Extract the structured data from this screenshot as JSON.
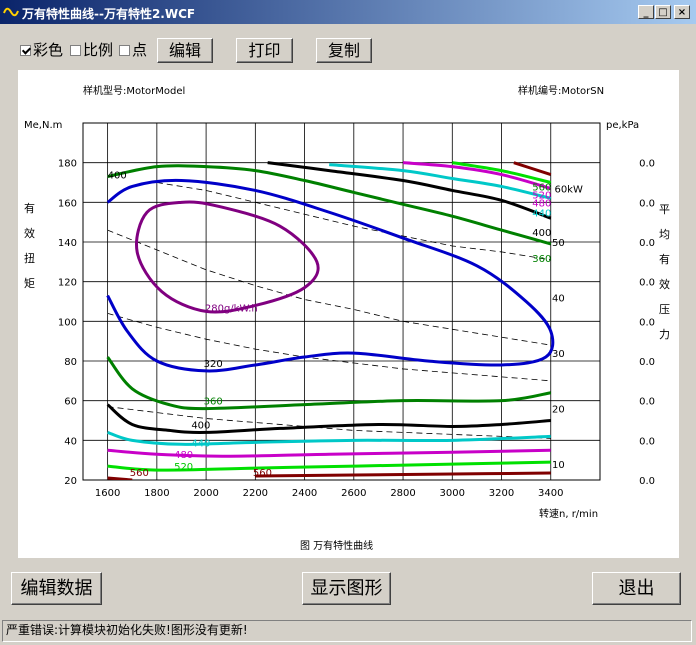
{
  "window": {
    "title": "万有特性曲线--万有特性2.WCF",
    "min_label": "_",
    "max_label": "□",
    "close_label": "×"
  },
  "toolbar": {
    "color_label": "彩色",
    "color_checked": true,
    "ratio_label": "比例",
    "ratio_checked": false,
    "point_label": "点",
    "point_checked": false,
    "edit_button": "编辑",
    "print_button": "打印",
    "copy_button": "复制"
  },
  "buttons": {
    "edit_data": "编辑数据",
    "show_chart": "显示图形",
    "exit": "退出"
  },
  "status": {
    "message": "严重错误:计算模块初始化失败!图形没有更新!"
  },
  "chart_data": {
    "type": "line",
    "model_label": "样机型号:MotorModel",
    "sn_label": "样机编号:MotorSN",
    "left_unit": "Me,N.m",
    "left_axis_title": [
      "有",
      "效",
      "扭",
      "矩"
    ],
    "right_unit": "pe,kPa",
    "right_axis_title": [
      "平",
      "均",
      "有",
      "效",
      "压",
      "力"
    ],
    "x_axis_label": "转速n, r/min",
    "caption": "图   万有特性曲线",
    "x_ticks": [
      1600,
      1800,
      2000,
      2200,
      2400,
      2600,
      2800,
      3000,
      3200,
      3400
    ],
    "y_ticks": [
      20,
      40,
      60,
      80,
      100,
      120,
      140,
      160,
      180
    ],
    "right_ticks": [
      "0.0",
      "0.0",
      "0.0",
      "0.0",
      "0.0",
      "0.0",
      "0.0",
      "0.0",
      "0.0"
    ],
    "xlim": [
      1600,
      3400
    ],
    "ylim": [
      20,
      180
    ],
    "power_labels": [
      {
        "text": "60kW",
        "x": 3415,
        "y": 167
      },
      {
        "text": "50",
        "x": 3405,
        "y": 140
      },
      {
        "text": "40",
        "x": 3405,
        "y": 112
      },
      {
        "text": "30",
        "x": 3405,
        "y": 84
      },
      {
        "text": "20",
        "x": 3405,
        "y": 56
      },
      {
        "text": "10",
        "x": 3405,
        "y": 28
      }
    ],
    "contour_labels": [
      {
        "text": "400",
        "x": 1600,
        "y": 174,
        "color": "#000000"
      },
      {
        "text": "280g/kW.h",
        "x": 1995,
        "y": 107,
        "color": "#800080"
      },
      {
        "text": "320",
        "x": 1990,
        "y": 79,
        "color": "#000000"
      },
      {
        "text": "360",
        "x": 1990,
        "y": 60,
        "color": "#008000"
      },
      {
        "text": "400",
        "x": 1940,
        "y": 48,
        "color": "#000000"
      },
      {
        "text": "440",
        "x": 1940,
        "y": 39,
        "color": "#00c8c8"
      },
      {
        "text": "480",
        "x": 1870,
        "y": 33,
        "color": "#c800c8"
      },
      {
        "text": "520",
        "x": 1870,
        "y": 27,
        "color": "#00c800"
      },
      {
        "text": "560",
        "x": 1690,
        "y": 24,
        "color": "#800000"
      },
      {
        "text": "560",
        "x": 2190,
        "y": 24,
        "color": "#800000"
      },
      {
        "text": "560",
        "x": 3325,
        "y": 168,
        "color": "#008000"
      },
      {
        "text": "520",
        "x": 3325,
        "y": 164,
        "color": "#c800c8"
      },
      {
        "text": "480",
        "x": 3325,
        "y": 160,
        "color": "#c800c8"
      },
      {
        "text": "440",
        "x": 3325,
        "y": 155,
        "color": "#00c8c8"
      },
      {
        "text": "400",
        "x": 3325,
        "y": 145,
        "color": "#000000"
      },
      {
        "text": "360",
        "x": 3325,
        "y": 132,
        "color": "#008000"
      }
    ],
    "series": [
      {
        "color": "#800080",
        "closed": true,
        "values": [
          [
            1900,
            160
          ],
          [
            2050,
            158
          ],
          [
            2300,
            148
          ],
          [
            2450,
            130
          ],
          [
            2400,
            117
          ],
          [
            2200,
            108
          ],
          [
            2000,
            105
          ],
          [
            1820,
            115
          ],
          [
            1720,
            135
          ],
          [
            1760,
            155
          ]
        ]
      },
      {
        "color": "#0000c8",
        "values": [
          [
            1600,
            160
          ],
          [
            1700,
            168
          ],
          [
            1900,
            171
          ],
          [
            2200,
            166
          ],
          [
            2500,
            155
          ],
          [
            2800,
            142
          ],
          [
            3100,
            128
          ],
          [
            3300,
            110
          ],
          [
            3400,
            95
          ],
          [
            3380,
            82
          ],
          [
            3200,
            78
          ],
          [
            2900,
            80
          ],
          [
            2600,
            84
          ],
          [
            2400,
            82
          ],
          [
            2200,
            78
          ],
          [
            2000,
            75
          ],
          [
            1800,
            80
          ],
          [
            1680,
            95
          ],
          [
            1600,
            113
          ]
        ]
      },
      {
        "color": "#008000",
        "values": [
          [
            1600,
            173
          ],
          [
            1800,
            178
          ],
          [
            2000,
            178
          ],
          [
            2200,
            176
          ],
          [
            2400,
            171
          ],
          [
            2600,
            165
          ],
          [
            2800,
            159
          ],
          [
            3000,
            153
          ],
          [
            3200,
            146
          ],
          [
            3400,
            139
          ]
        ]
      },
      {
        "color": "#008000",
        "values": [
          [
            1600,
            82
          ],
          [
            1700,
            66
          ],
          [
            1850,
            58
          ],
          [
            2000,
            56
          ],
          [
            2400,
            58
          ],
          [
            2800,
            60
          ],
          [
            3200,
            60
          ],
          [
            3400,
            64
          ]
        ]
      },
      {
        "color": "#000000",
        "values": [
          [
            1600,
            58
          ],
          [
            1700,
            48
          ],
          [
            1850,
            45
          ],
          [
            2000,
            44
          ],
          [
            2300,
            46
          ],
          [
            2700,
            48
          ],
          [
            3000,
            47
          ],
          [
            3200,
            48
          ],
          [
            3400,
            50
          ]
        ]
      },
      {
        "color": "#000000",
        "values": [
          [
            2250,
            180
          ],
          [
            2500,
            176
          ],
          [
            2800,
            171
          ],
          [
            3000,
            166
          ],
          [
            3200,
            161
          ],
          [
            3400,
            152
          ]
        ]
      },
      {
        "color": "#00c8c8",
        "values": [
          [
            1600,
            44
          ],
          [
            1700,
            40
          ],
          [
            1900,
            38
          ],
          [
            2200,
            39
          ],
          [
            2600,
            40
          ],
          [
            3000,
            40
          ],
          [
            3400,
            42
          ]
        ]
      },
      {
        "color": "#00c8c8",
        "values": [
          [
            2500,
            179
          ],
          [
            2800,
            176
          ],
          [
            3000,
            172
          ],
          [
            3200,
            168
          ],
          [
            3400,
            162
          ]
        ]
      },
      {
        "color": "#c800c8",
        "values": [
          [
            1600,
            35
          ],
          [
            1800,
            33
          ],
          [
            2100,
            32
          ],
          [
            2500,
            33
          ],
          [
            3000,
            34
          ],
          [
            3400,
            35
          ]
        ]
      },
      {
        "color": "#c800c8",
        "values": [
          [
            2800,
            180
          ],
          [
            3000,
            178
          ],
          [
            3200,
            174
          ],
          [
            3400,
            167
          ]
        ]
      },
      {
        "color": "#00e000",
        "values": [
          [
            1600,
            27
          ],
          [
            1800,
            25
          ],
          [
            2200,
            26
          ],
          [
            2600,
            27
          ],
          [
            3000,
            28
          ],
          [
            3400,
            29
          ]
        ]
      },
      {
        "color": "#00e000",
        "values": [
          [
            3000,
            180
          ],
          [
            3200,
            176
          ],
          [
            3400,
            170
          ]
        ]
      },
      {
        "color": "#800000",
        "values": [
          [
            1600,
            21
          ],
          [
            1700,
            20
          ]
        ]
      },
      {
        "color": "#800000",
        "values": [
          [
            2200,
            22
          ],
          [
            2600,
            22.5
          ],
          [
            3000,
            23
          ],
          [
            3400,
            23.5
          ]
        ]
      },
      {
        "color": "#800000",
        "values": [
          [
            3250,
            180
          ],
          [
            3400,
            174
          ]
        ]
      }
    ],
    "power_curves": [
      {
        "label": "60kW",
        "values": [
          [
            1800,
            170
          ],
          [
            2000,
            166
          ],
          [
            2200,
            160
          ],
          [
            2400,
            154
          ],
          [
            2600,
            148
          ],
          [
            2800,
            143
          ],
          [
            3000,
            138
          ],
          [
            3200,
            135
          ],
          [
            3400,
            131
          ]
        ]
      },
      {
        "label": "40",
        "values": [
          [
            1600,
            146
          ],
          [
            1800,
            136
          ],
          [
            2000,
            126
          ],
          [
            2200,
            118
          ],
          [
            2400,
            111
          ],
          [
            2600,
            106
          ],
          [
            2800,
            100
          ],
          [
            3000,
            96
          ],
          [
            3200,
            92
          ],
          [
            3400,
            88
          ]
        ]
      },
      {
        "label": "30",
        "values": [
          [
            1600,
            104
          ],
          [
            1800,
            97
          ],
          [
            2000,
            91
          ],
          [
            2200,
            86
          ],
          [
            2400,
            82
          ],
          [
            2600,
            79
          ],
          [
            2800,
            76
          ],
          [
            3000,
            74
          ],
          [
            3200,
            72
          ],
          [
            3400,
            70
          ]
        ]
      },
      {
        "label": "20",
        "values": [
          [
            1600,
            57
          ],
          [
            1800,
            54
          ],
          [
            2000,
            51
          ],
          [
            2200,
            49
          ],
          [
            2400,
            47
          ],
          [
            2600,
            45
          ],
          [
            2800,
            44
          ],
          [
            3000,
            43
          ],
          [
            3200,
            42
          ],
          [
            3400,
            41
          ]
        ]
      }
    ]
  }
}
